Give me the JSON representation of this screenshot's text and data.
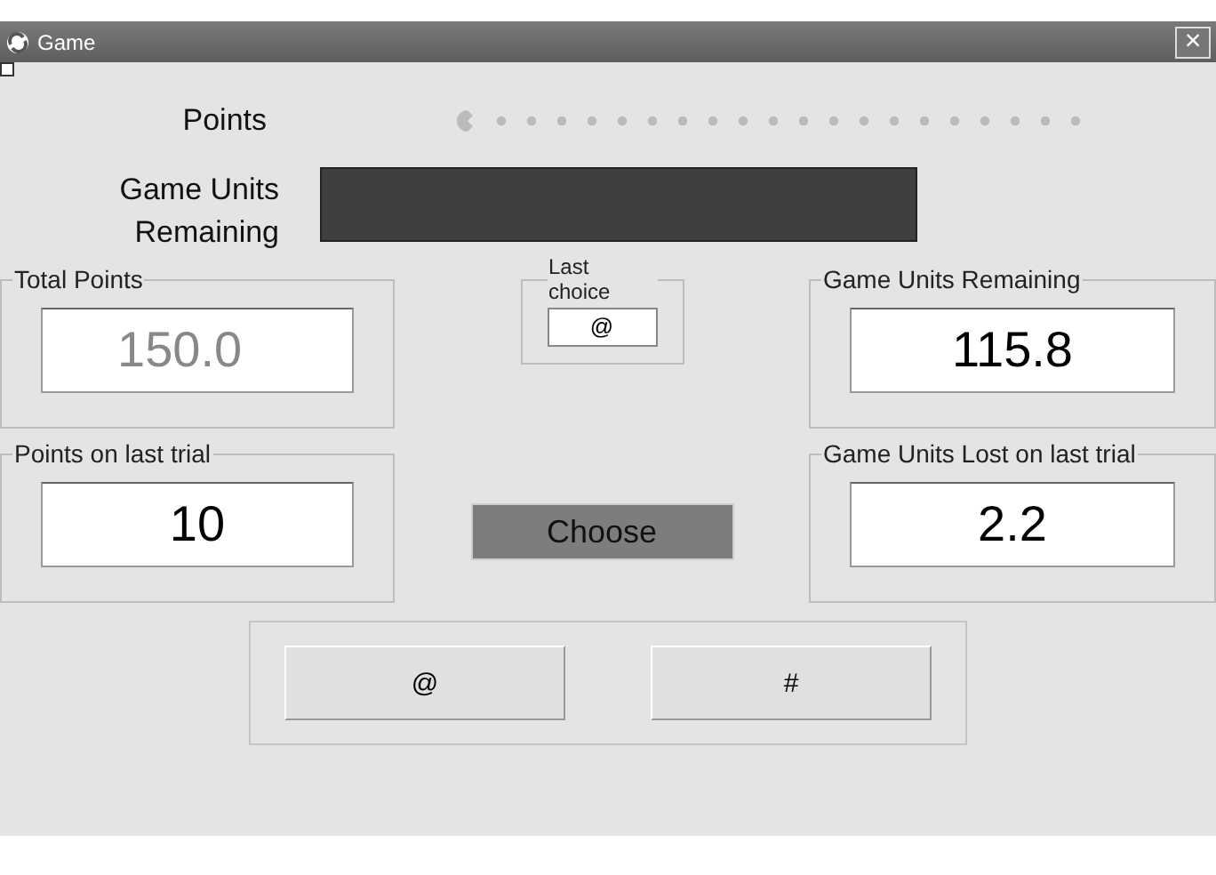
{
  "window": {
    "title": "Game",
    "close": "×"
  },
  "points_label": "Points",
  "units_label": "Game Units\nRemaining",
  "left_groups": [
    {
      "title": "Total Points",
      "value": "150.0",
      "disabled": true
    },
    {
      "title": "Points on last trial",
      "value": "10",
      "disabled": false
    }
  ],
  "last_choice": {
    "title": "Last choice",
    "value": "@"
  },
  "choose_button": {
    "label": "Choose",
    "disabled": true
  },
  "right_groups": [
    {
      "title": "Game Units Remaining",
      "value": "115.8",
      "disabled": false
    },
    {
      "title": "Game Units Lost on last trial",
      "value": "2.2",
      "disabled": false
    }
  ],
  "option_buttons": [
    "@",
    "#"
  ]
}
